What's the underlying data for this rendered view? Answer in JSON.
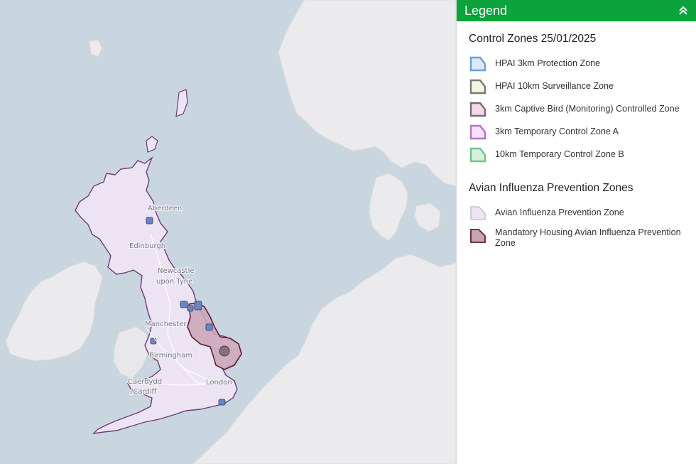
{
  "map": {
    "cities": [
      "Aberdeen",
      "Edinburgh",
      "Newcastle",
      "upon Tyne",
      "Manchester",
      "Birmingham",
      "Caerdydd",
      "/Cardiff",
      "London"
    ]
  },
  "legend": {
    "title": "Legend",
    "sections": [
      {
        "title": "Control Zones 25/01/2025",
        "items": [
          {
            "label": "HPAI 3km Protection Zone",
            "stroke": "#6a9fd8",
            "fill": "#dbe8f7"
          },
          {
            "label": "HPAI 10km Surveillance Zone",
            "stroke": "#767a70",
            "fill": "#f4f4e0"
          },
          {
            "label": "3km Captive Bird (Monitoring) Controlled Zone",
            "stroke": "#7a6872",
            "fill": "#f4d8ea"
          },
          {
            "label": "3km Temporary Control Zone A",
            "stroke": "#b173c9",
            "fill": "#f3e3f5"
          },
          {
            "label": "10km Temporary Control Zone B",
            "stroke": "#72c287",
            "fill": "#d8efdc"
          }
        ]
      },
      {
        "title": "Avian Influenza Prevention Zones",
        "items": [
          {
            "label": "Avian Influenza Prevention Zone",
            "stroke": "#cdbfdd",
            "fill": "#ede4f3"
          },
          {
            "label": "Mandatory Housing Avian Influenza Prevention Zone",
            "stroke": "#5e1f33",
            "fill": "#c9a4b6"
          }
        ]
      }
    ]
  }
}
